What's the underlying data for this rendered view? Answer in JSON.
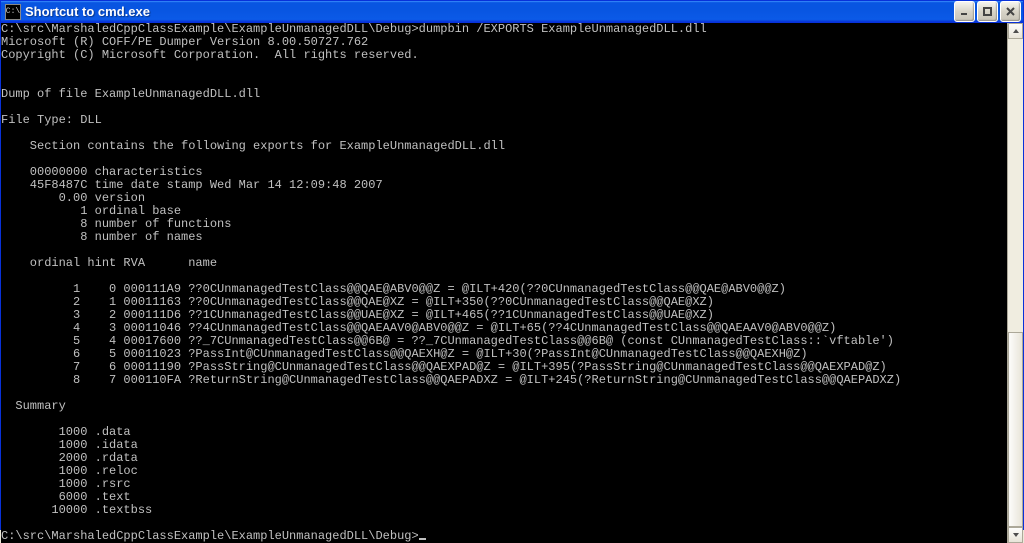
{
  "window": {
    "title": "Shortcut to cmd.exe",
    "icon_label": "C:\\"
  },
  "console": {
    "prompt1": "C:\\src\\MarshaledCppClassExample\\ExampleUnmanagedDLL\\Debug>dumpbin /EXPORTS ExampleUnmanagedDLL.dll",
    "line2": "Microsoft (R) COFF/PE Dumper Version 8.00.50727.762",
    "line3": "Copyright (C) Microsoft Corporation.  All rights reserved.",
    "blank": "",
    "dump_of": "Dump of file ExampleUnmanagedDLL.dll",
    "file_type": "File Type: DLL",
    "section_hdr": "    Section contains the following exports for ExampleUnmanagedDLL.dll",
    "chars": "    00000000 characteristics",
    "timestamp": "    45F8487C time date stamp Wed Mar 14 12:09:48 2007",
    "version": "        0.00 version",
    "ord_base": "           1 ordinal base",
    "num_funcs": "           8 number of functions",
    "num_names": "           8 number of names",
    "col_hdr": "    ordinal hint RVA      name",
    "row1": "          1    0 000111A9 ??0CUnmanagedTestClass@@QAE@ABV0@@Z = @ILT+420(??0CUnmanagedTestClass@@QAE@ABV0@@Z)",
    "row2": "          2    1 00011163 ??0CUnmanagedTestClass@@QAE@XZ = @ILT+350(??0CUnmanagedTestClass@@QAE@XZ)",
    "row3": "          3    2 000111D6 ??1CUnmanagedTestClass@@UAE@XZ = @ILT+465(??1CUnmanagedTestClass@@UAE@XZ)",
    "row4": "          4    3 00011046 ??4CUnmanagedTestClass@@QAEAAV0@ABV0@@Z = @ILT+65(??4CUnmanagedTestClass@@QAEAAV0@ABV0@@Z)",
    "row5": "          5    4 00017600 ??_7CUnmanagedTestClass@@6B@ = ??_7CUnmanagedTestClass@@6B@ (const CUnmanagedTestClass::`vftable')",
    "row6": "          6    5 00011023 ?PassInt@CUnmanagedTestClass@@QAEXH@Z = @ILT+30(?PassInt@CUnmanagedTestClass@@QAEXH@Z)",
    "row7": "          7    6 00011190 ?PassString@CUnmanagedTestClass@@QAEXPAD@Z = @ILT+395(?PassString@CUnmanagedTestClass@@QAEXPAD@Z)",
    "row8": "          8    7 000110FA ?ReturnString@CUnmanagedTestClass@@QAEPADXZ = @ILT+245(?ReturnString@CUnmanagedTestClass@@QAEPADXZ)",
    "summary_hdr": "  Summary",
    "s1": "        1000 .data",
    "s2": "        1000 .idata",
    "s3": "        2000 .rdata",
    "s4": "        1000 .reloc",
    "s5": "        1000 .rsrc",
    "s6": "        6000 .text",
    "s7": "       10000 .textbss",
    "prompt2": "C:\\src\\MarshaledCppClassExample\\ExampleUnmanagedDLL\\Debug>"
  }
}
